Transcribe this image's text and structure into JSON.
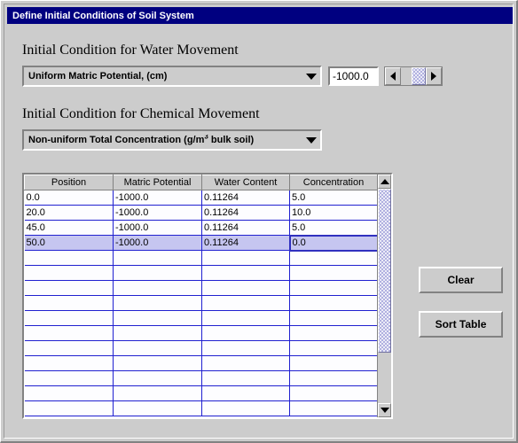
{
  "window": {
    "title": "Define Initial Conditions of Soil System"
  },
  "water_section": {
    "heading": "Initial Condition for Water Movement",
    "dropdown_selected": "Uniform Matric Potential, (cm)",
    "dropdown_icon": "chevron-down-icon",
    "value": "-1000.0",
    "scroll_left_icon": "triangle-left-icon",
    "scroll_right_icon": "triangle-right-icon"
  },
  "chemical_section": {
    "heading": "Initial Condition for Chemical Movement",
    "dropdown_selected_prefix": "Non-uniform Total Concentration (g/m",
    "dropdown_selected_sup": "3",
    "dropdown_selected_suffix": " bulk soil)",
    "dropdown_icon": "chevron-down-icon"
  },
  "table": {
    "columns": [
      "Position",
      "Matric Potential",
      "Water Content",
      "Concentration"
    ],
    "rows": [
      {
        "cells": [
          "0.0",
          "-1000.0",
          "0.11264",
          "5.0"
        ],
        "selected": false,
        "editing_col": -1
      },
      {
        "cells": [
          "20.0",
          "-1000.0",
          "0.11264",
          "10.0"
        ],
        "selected": false,
        "editing_col": -1
      },
      {
        "cells": [
          "45.0",
          "-1000.0",
          "0.11264",
          "5.0"
        ],
        "selected": false,
        "editing_col": -1
      },
      {
        "cells": [
          "50.0",
          "-1000.0",
          "0.11264",
          "0.0"
        ],
        "selected": true,
        "editing_col": 3
      },
      {
        "cells": [
          "",
          "",
          "",
          ""
        ],
        "selected": false,
        "editing_col": -1
      },
      {
        "cells": [
          "",
          "",
          "",
          ""
        ],
        "selected": false,
        "editing_col": -1
      },
      {
        "cells": [
          "",
          "",
          "",
          ""
        ],
        "selected": false,
        "editing_col": -1
      },
      {
        "cells": [
          "",
          "",
          "",
          ""
        ],
        "selected": false,
        "editing_col": -1
      },
      {
        "cells": [
          "",
          "",
          "",
          ""
        ],
        "selected": false,
        "editing_col": -1
      },
      {
        "cells": [
          "",
          "",
          "",
          ""
        ],
        "selected": false,
        "editing_col": -1
      },
      {
        "cells": [
          "",
          "",
          "",
          ""
        ],
        "selected": false,
        "editing_col": -1
      },
      {
        "cells": [
          "",
          "",
          "",
          ""
        ],
        "selected": false,
        "editing_col": -1
      },
      {
        "cells": [
          "",
          "",
          "",
          ""
        ],
        "selected": false,
        "editing_col": -1
      },
      {
        "cells": [
          "",
          "",
          "",
          ""
        ],
        "selected": false,
        "editing_col": -1
      },
      {
        "cells": [
          "",
          "",
          "",
          ""
        ],
        "selected": false,
        "editing_col": -1
      }
    ],
    "scroll_up_icon": "triangle-up-icon",
    "scroll_down_icon": "triangle-down-icon"
  },
  "buttons": {
    "clear": "Clear",
    "sort_table": "Sort Table"
  },
  "colors": {
    "titlebar": "#000080",
    "face": "#cccccc",
    "grid_line": "#2020d0",
    "selection": "#c6c6f0",
    "thumb": "#b0b0e0"
  }
}
